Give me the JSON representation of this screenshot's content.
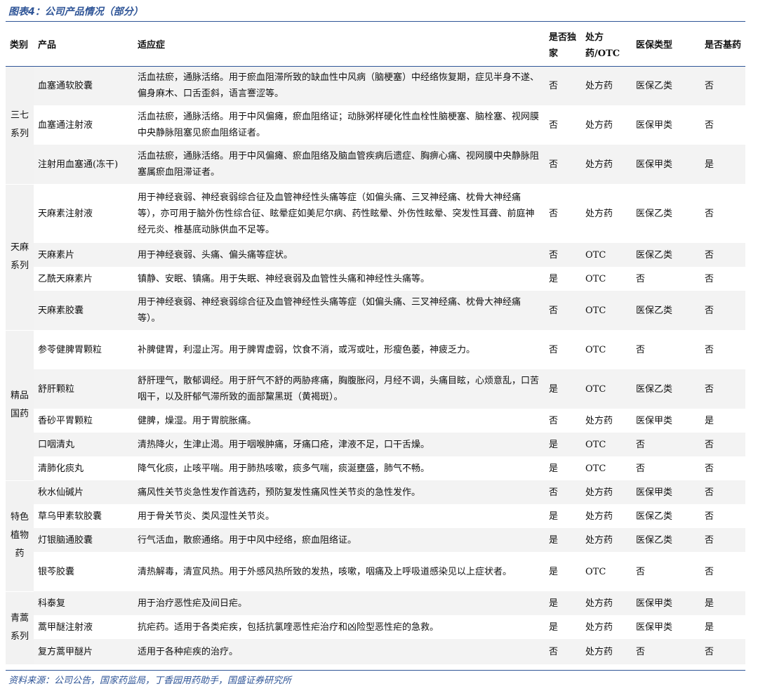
{
  "caption": "图表4：公司产品情况（部分）",
  "headers": {
    "category": "类别",
    "product": "产品",
    "indication": "适应症",
    "exclusive": "是否独家",
    "type": "处方药/OTC",
    "insurance": "医保类型",
    "essential": "是否基药"
  },
  "categories": [
    "三七系列",
    "天麻系列",
    "精品国药",
    "特色植物药",
    "青蒿系列"
  ],
  "rows": [
    {
      "product": "血塞通软胶囊",
      "indication": "活血祛瘀，通脉活络。用于瘀血阻滞所致的缺血性中风病（脑梗塞）中经络恢复期，症见半身不遂、偏身麻木、口舌歪斜，语言謇涩等。",
      "exclusive": "否",
      "type": "处方药",
      "insurance": "医保乙类",
      "essential": "否"
    },
    {
      "product": "血塞通注射液",
      "indication": "活血祛瘀，通脉活络。用于中风偏瘫，瘀血阻络证；动脉粥样硬化性血栓性脑梗塞、脑栓塞、视网膜中央静脉阻塞见瘀血阻络证者。",
      "exclusive": "否",
      "type": "处方药",
      "insurance": "医保甲类",
      "essential": "否"
    },
    {
      "product": "注射用血塞通(冻干)",
      "indication": "活血祛瘀，通脉活络。用于中风偏瘫、瘀血阻络及脑血管疾病后遗症、胸痹心痛、视网膜中央静脉阻塞属瘀血阻滞证者。",
      "exclusive": "否",
      "type": "处方药",
      "insurance": "医保甲类",
      "essential": "是"
    },
    {
      "product": "天麻素注射液",
      "indication": "用于神经衰弱、神经衰弱综合征及血管神经性头痛等症（如偏头痛、三叉神经痛、枕骨大神经痛等），亦可用于脑外伤性综合征、眩晕症如美尼尔病、药性眩晕、外伤性眩晕、突发性耳聋、前庭神经元炎、椎基底动脉供血不足等。",
      "exclusive": "否",
      "type": "处方药",
      "insurance": "医保乙类",
      "essential": "否"
    },
    {
      "product": "天麻素片",
      "indication": "用于神经衰弱、头痛、偏头痛等症状。",
      "exclusive": "否",
      "type": "OTC",
      "insurance": "医保乙类",
      "essential": "否"
    },
    {
      "product": "乙酰天麻素片",
      "indication": "镇静、安眠、镇痛。用于失眠、神经衰弱及血管性头痛和神经性头痛等。",
      "exclusive": "是",
      "type": "OTC",
      "insurance": "否",
      "essential": "否"
    },
    {
      "product": "天麻素胶囊",
      "indication": "用于神经衰弱、神经衰弱综合征及血管神经性头痛等症（如偏头痛、三叉神经痛、枕骨大神经痛等）。",
      "exclusive": "否",
      "type": "OTC",
      "insurance": "医保乙类",
      "essential": "否"
    },
    {
      "product": "参苓健脾胃颗粒",
      "indication": "补脾健胃，利湿止泻。用于脾胃虚弱，饮食不消，或泻或吐，形瘦色萎，神疲乏力。",
      "exclusive": "否",
      "type": "OTC",
      "insurance": "否",
      "essential": "否"
    },
    {
      "product": "舒肝颗粒",
      "indication": "舒肝理气，散郁调经。用于肝气不舒的两胁疼痛，胸腹胀闷，月经不调，头痛目眩，心烦意乱，口苦咽干，以及肝郁气滞所致的面部黧黑斑（黄褐斑）。",
      "exclusive": "是",
      "type": "OTC",
      "insurance": "医保乙类",
      "essential": "否"
    },
    {
      "product": "香砂平胃颗粒",
      "indication": "健脾，燥湿。用于胃脘胀痛。",
      "exclusive": "否",
      "type": "处方药",
      "insurance": "医保甲类",
      "essential": "是"
    },
    {
      "product": "口咽清丸",
      "indication": "清热降火，生津止渴。用于咽喉肿痛，牙痛口疮，津液不足，口干舌燥。",
      "exclusive": "是",
      "type": "OTC",
      "insurance": "否",
      "essential": "否"
    },
    {
      "product": "清肺化痰丸",
      "indication": "降气化痰，止咳平喘。用于肺热咳嗽，痰多气喘，痰涎壅盛，肺气不畅。",
      "exclusive": "是",
      "type": "OTC",
      "insurance": "否",
      "essential": "否"
    },
    {
      "product": "秋水仙碱片",
      "indication": "痛风性关节炎急性发作首选药，预防复发性痛风性关节炎的急性发作。",
      "exclusive": "否",
      "type": "处方药",
      "insurance": "医保甲类",
      "essential": "否"
    },
    {
      "product": "草乌甲素软胶囊",
      "indication": "用于骨关节炎、类风湿性关节炎。",
      "exclusive": "是",
      "type": "处方药",
      "insurance": "医保乙类",
      "essential": "否"
    },
    {
      "product": "灯银脑通胶囊",
      "indication": "行气活血，散瘀通络。用于中风中经络，瘀血阻络证。",
      "exclusive": "是",
      "type": "处方药",
      "insurance": "医保乙类",
      "essential": "否"
    },
    {
      "product": "银芩胶囊",
      "indication": "清热解毒，清宣风热。用于外感风热所致的发热，咳嗽，咽痛及上呼吸道感染见以上症状者。",
      "exclusive": "是",
      "type": "OTC",
      "insurance": "否",
      "essential": "否"
    },
    {
      "product": "科泰复",
      "indication": "用于治疗恶性疟及间日疟。",
      "exclusive": "是",
      "type": "处方药",
      "insurance": "医保甲类",
      "essential": "是"
    },
    {
      "product": "蒿甲醚注射液",
      "indication": "抗疟药。适用于各类疟疾，包括抗氯喹恶性疟治疗和凶险型恶性疟的急救。",
      "exclusive": "是",
      "type": "处方药",
      "insurance": "医保甲类",
      "essential": "是"
    },
    {
      "product": "复方蒿甲醚片",
      "indication": "适用于各种疟疾的治疗。",
      "exclusive": "否",
      "type": "处方药",
      "insurance": "否",
      "essential": "否"
    }
  ],
  "source": "资料来源：公司公告，国家药监局，丁香园用药助手，国盛证券研究所"
}
